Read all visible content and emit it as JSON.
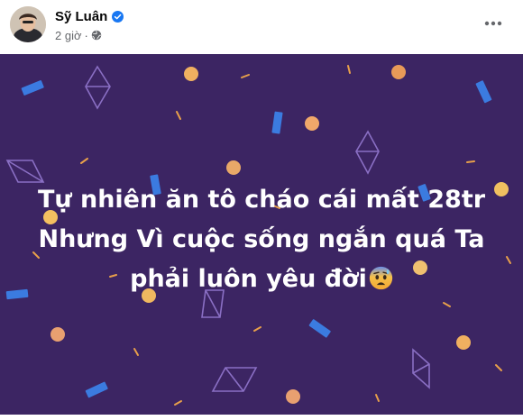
{
  "post": {
    "author": "Sỹ Luân",
    "time": "2 giờ",
    "separator": "·",
    "icons": {
      "verified": "verified-badge-icon",
      "audience": "globe-icon",
      "more": "more-horizontal-icon",
      "emoji": "anxious-face-with-sweat-emoji"
    },
    "text_lines": [
      "Tự nhiên ăn tô cháo cái mất 28tr",
      "Nhưng Vì cuộc sống ngắn quá Ta",
      "phải luôn yêu đời"
    ],
    "colors": {
      "background": "#3c2563",
      "text": "#ffffff",
      "accent_blue": "#3b7be0",
      "accent_orange": "#e8a04a",
      "accent_outline": "#8a6fc4",
      "verified": "#1877f2",
      "meta_text": "#65676b"
    }
  }
}
